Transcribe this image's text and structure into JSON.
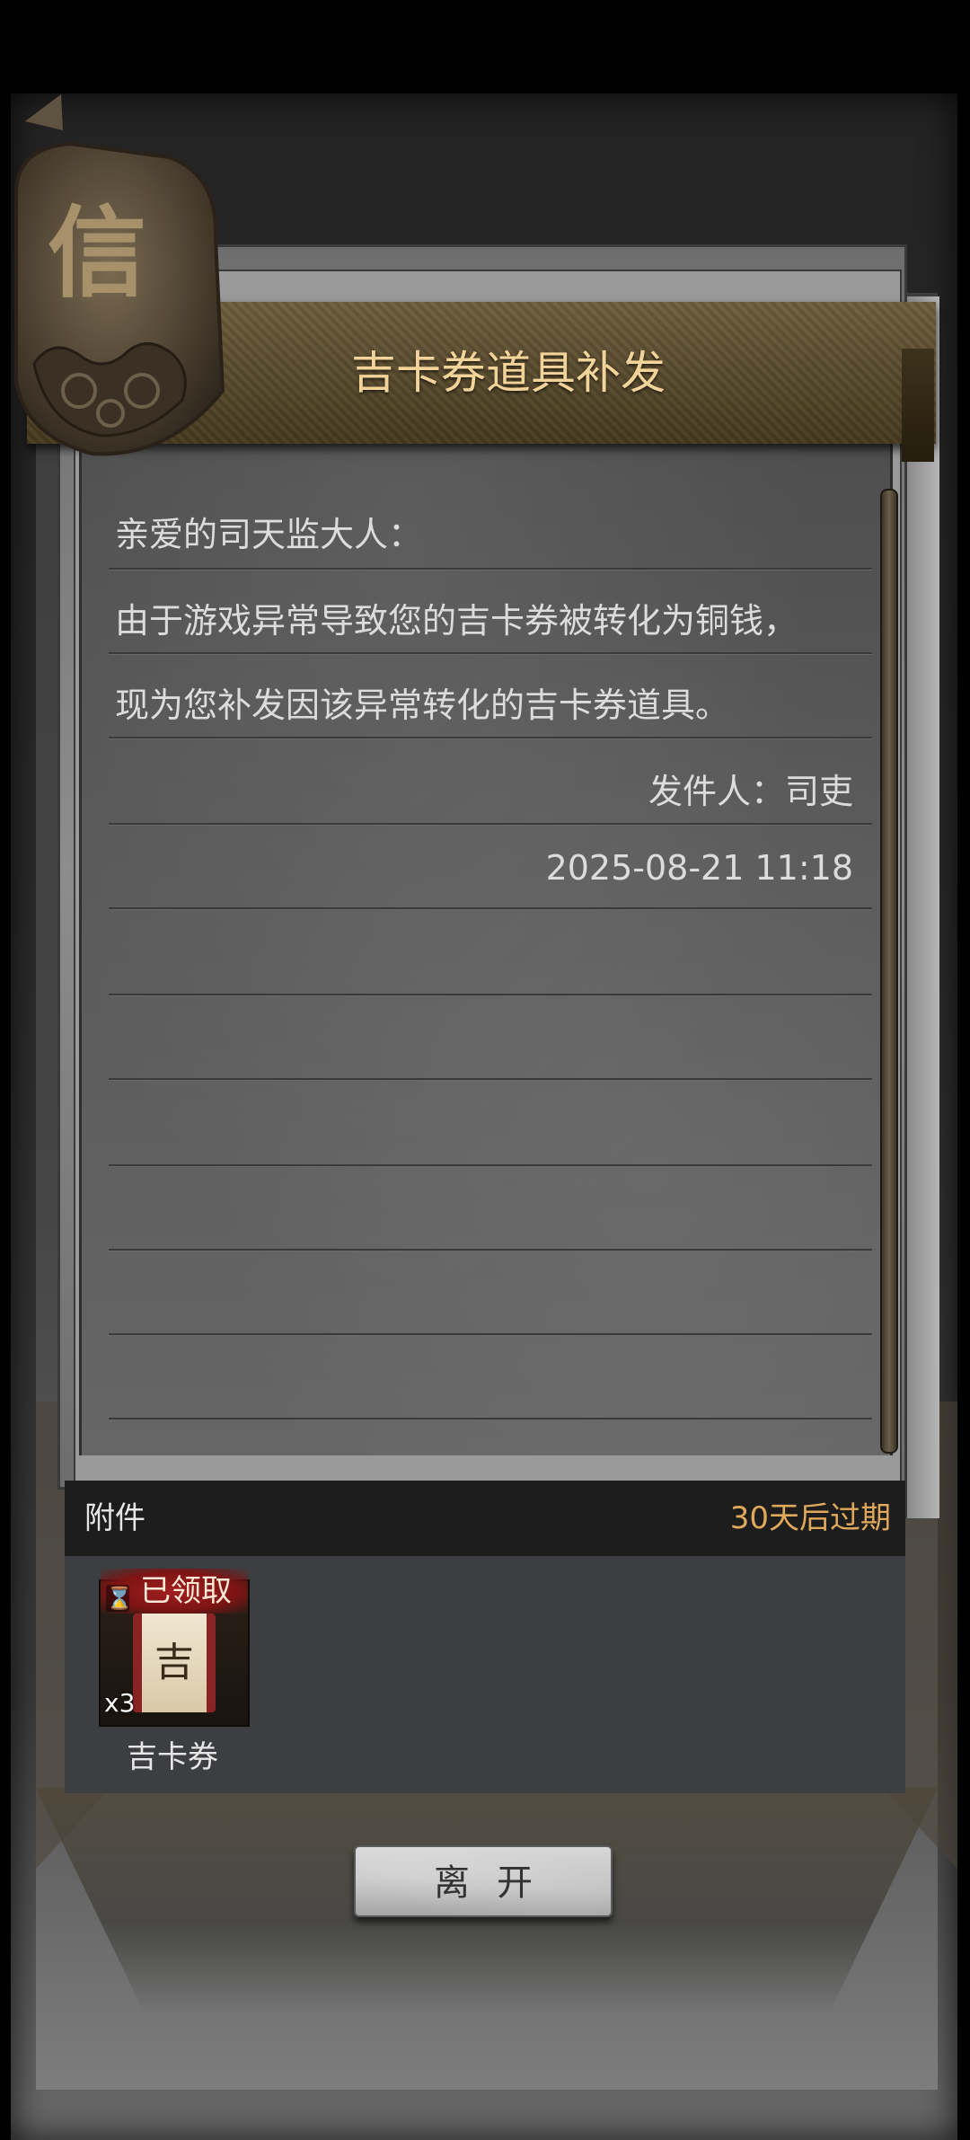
{
  "mail": {
    "title": "吉卡券道具补发",
    "seal_char": "信",
    "greeting": "亲爱的司天监大人：",
    "body_line1": "由于游戏异常导致您的吉卡券被转化为铜钱，",
    "body_line2": "现为您补发因该异常转化的吉卡券道具。",
    "sender": "发件人：司吏",
    "timestamp": "2025-08-21 11:18"
  },
  "attachments": {
    "label": "附件",
    "expire": "30天后过期",
    "items": [
      {
        "name": "吉卡券",
        "count": "x3",
        "status": "已领取",
        "glyph": "吉",
        "icon": "hourglass-icon"
      }
    ]
  },
  "actions": {
    "leave_label": "离开"
  },
  "colors": {
    "title_gold": "#f2d49a",
    "expire_orange": "#e0a85a",
    "claimed_red": "#a21f1f"
  }
}
